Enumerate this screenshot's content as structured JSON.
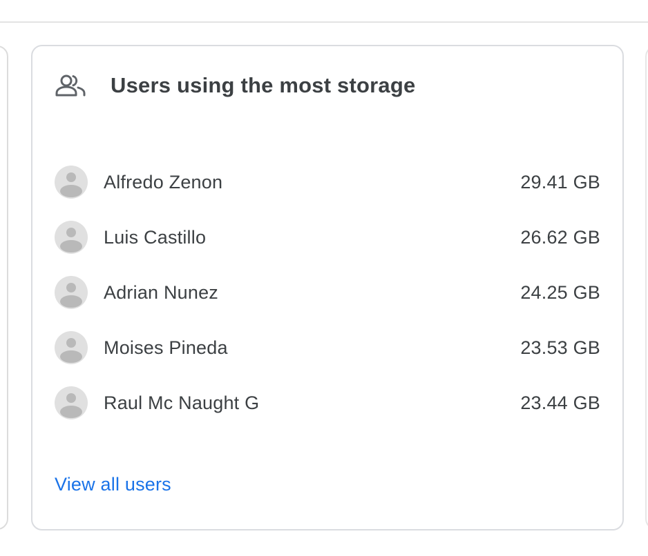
{
  "card": {
    "icon": "users-icon",
    "title": "Users using the most storage",
    "users": [
      {
        "name": "Alfredo Zenon",
        "storage": "29.41 GB"
      },
      {
        "name": "Luis Castillo",
        "storage": "26.62 GB"
      },
      {
        "name": "Adrian Nunez",
        "storage": "24.25 GB"
      },
      {
        "name": "Moises Pineda",
        "storage": "23.53 GB"
      },
      {
        "name": "Raul Mc Naught G",
        "storage": "23.44 GB"
      }
    ],
    "view_all_label": "View all users"
  },
  "colors": {
    "text": "#3c4043",
    "link": "#1a73e8",
    "border": "#dadce0",
    "avatar_bg": "#e0e0e0"
  }
}
